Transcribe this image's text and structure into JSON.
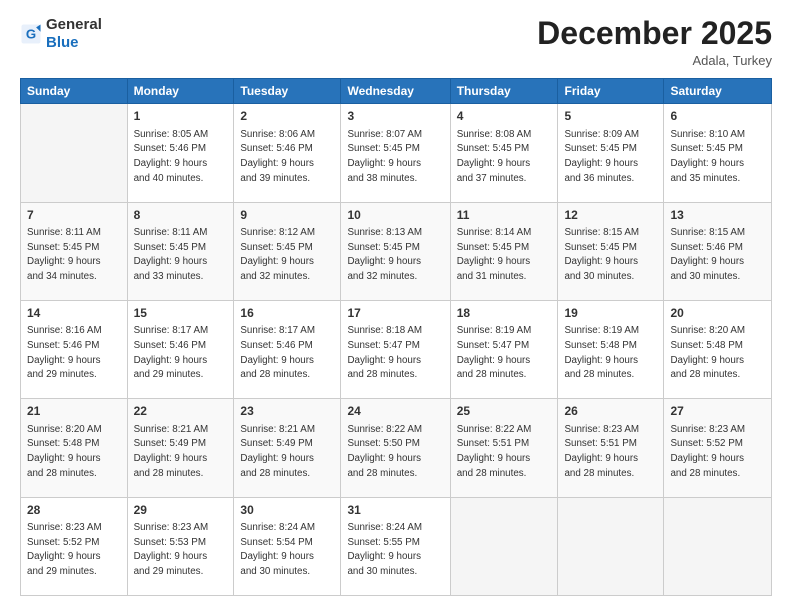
{
  "header": {
    "logo_general": "General",
    "logo_blue": "Blue",
    "month": "December 2025",
    "location": "Adala, Turkey"
  },
  "weekdays": [
    "Sunday",
    "Monday",
    "Tuesday",
    "Wednesday",
    "Thursday",
    "Friday",
    "Saturday"
  ],
  "weeks": [
    [
      {
        "day": "",
        "info": ""
      },
      {
        "day": "1",
        "info": "Sunrise: 8:05 AM\nSunset: 5:46 PM\nDaylight: 9 hours\nand 40 minutes."
      },
      {
        "day": "2",
        "info": "Sunrise: 8:06 AM\nSunset: 5:46 PM\nDaylight: 9 hours\nand 39 minutes."
      },
      {
        "day": "3",
        "info": "Sunrise: 8:07 AM\nSunset: 5:45 PM\nDaylight: 9 hours\nand 38 minutes."
      },
      {
        "day": "4",
        "info": "Sunrise: 8:08 AM\nSunset: 5:45 PM\nDaylight: 9 hours\nand 37 minutes."
      },
      {
        "day": "5",
        "info": "Sunrise: 8:09 AM\nSunset: 5:45 PM\nDaylight: 9 hours\nand 36 minutes."
      },
      {
        "day": "6",
        "info": "Sunrise: 8:10 AM\nSunset: 5:45 PM\nDaylight: 9 hours\nand 35 minutes."
      }
    ],
    [
      {
        "day": "7",
        "info": "Sunrise: 8:11 AM\nSunset: 5:45 PM\nDaylight: 9 hours\nand 34 minutes."
      },
      {
        "day": "8",
        "info": "Sunrise: 8:11 AM\nSunset: 5:45 PM\nDaylight: 9 hours\nand 33 minutes."
      },
      {
        "day": "9",
        "info": "Sunrise: 8:12 AM\nSunset: 5:45 PM\nDaylight: 9 hours\nand 32 minutes."
      },
      {
        "day": "10",
        "info": "Sunrise: 8:13 AM\nSunset: 5:45 PM\nDaylight: 9 hours\nand 32 minutes."
      },
      {
        "day": "11",
        "info": "Sunrise: 8:14 AM\nSunset: 5:45 PM\nDaylight: 9 hours\nand 31 minutes."
      },
      {
        "day": "12",
        "info": "Sunrise: 8:15 AM\nSunset: 5:45 PM\nDaylight: 9 hours\nand 30 minutes."
      },
      {
        "day": "13",
        "info": "Sunrise: 8:15 AM\nSunset: 5:46 PM\nDaylight: 9 hours\nand 30 minutes."
      }
    ],
    [
      {
        "day": "14",
        "info": "Sunrise: 8:16 AM\nSunset: 5:46 PM\nDaylight: 9 hours\nand 29 minutes."
      },
      {
        "day": "15",
        "info": "Sunrise: 8:17 AM\nSunset: 5:46 PM\nDaylight: 9 hours\nand 29 minutes."
      },
      {
        "day": "16",
        "info": "Sunrise: 8:17 AM\nSunset: 5:46 PM\nDaylight: 9 hours\nand 28 minutes."
      },
      {
        "day": "17",
        "info": "Sunrise: 8:18 AM\nSunset: 5:47 PM\nDaylight: 9 hours\nand 28 minutes."
      },
      {
        "day": "18",
        "info": "Sunrise: 8:19 AM\nSunset: 5:47 PM\nDaylight: 9 hours\nand 28 minutes."
      },
      {
        "day": "19",
        "info": "Sunrise: 8:19 AM\nSunset: 5:48 PM\nDaylight: 9 hours\nand 28 minutes."
      },
      {
        "day": "20",
        "info": "Sunrise: 8:20 AM\nSunset: 5:48 PM\nDaylight: 9 hours\nand 28 minutes."
      }
    ],
    [
      {
        "day": "21",
        "info": "Sunrise: 8:20 AM\nSunset: 5:48 PM\nDaylight: 9 hours\nand 28 minutes."
      },
      {
        "day": "22",
        "info": "Sunrise: 8:21 AM\nSunset: 5:49 PM\nDaylight: 9 hours\nand 28 minutes."
      },
      {
        "day": "23",
        "info": "Sunrise: 8:21 AM\nSunset: 5:49 PM\nDaylight: 9 hours\nand 28 minutes."
      },
      {
        "day": "24",
        "info": "Sunrise: 8:22 AM\nSunset: 5:50 PM\nDaylight: 9 hours\nand 28 minutes."
      },
      {
        "day": "25",
        "info": "Sunrise: 8:22 AM\nSunset: 5:51 PM\nDaylight: 9 hours\nand 28 minutes."
      },
      {
        "day": "26",
        "info": "Sunrise: 8:23 AM\nSunset: 5:51 PM\nDaylight: 9 hours\nand 28 minutes."
      },
      {
        "day": "27",
        "info": "Sunrise: 8:23 AM\nSunset: 5:52 PM\nDaylight: 9 hours\nand 28 minutes."
      }
    ],
    [
      {
        "day": "28",
        "info": "Sunrise: 8:23 AM\nSunset: 5:52 PM\nDaylight: 9 hours\nand 29 minutes."
      },
      {
        "day": "29",
        "info": "Sunrise: 8:23 AM\nSunset: 5:53 PM\nDaylight: 9 hours\nand 29 minutes."
      },
      {
        "day": "30",
        "info": "Sunrise: 8:24 AM\nSunset: 5:54 PM\nDaylight: 9 hours\nand 30 minutes."
      },
      {
        "day": "31",
        "info": "Sunrise: 8:24 AM\nSunset: 5:55 PM\nDaylight: 9 hours\nand 30 minutes."
      },
      {
        "day": "",
        "info": ""
      },
      {
        "day": "",
        "info": ""
      },
      {
        "day": "",
        "info": ""
      }
    ]
  ]
}
